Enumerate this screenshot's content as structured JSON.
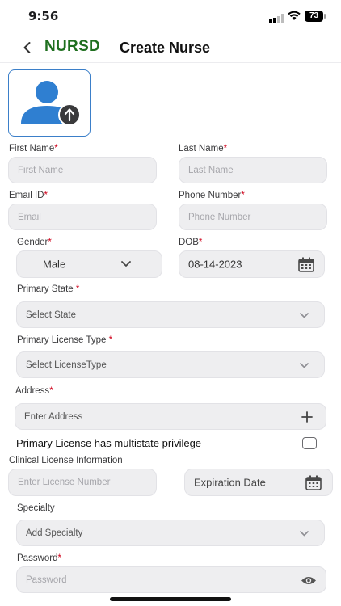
{
  "status_bar": {
    "time": "9:56",
    "battery": "73"
  },
  "header": {
    "brand": "NURSD",
    "title": "Create Nurse",
    "brand_color": "#1f6f1f"
  },
  "avatar": {
    "icon": "user-upload-icon",
    "accent": "#2f7fd1"
  },
  "form": {
    "first_name": {
      "label": "First Name",
      "placeholder": "First Name"
    },
    "last_name": {
      "label": "Last Name",
      "placeholder": "Last Name"
    },
    "email": {
      "label": "Email ID",
      "placeholder": "Email"
    },
    "phone": {
      "label": "Phone Number",
      "placeholder": "Phone Number"
    },
    "gender": {
      "label": "Gender",
      "value": "Male"
    },
    "dob": {
      "label": "DOB",
      "value": "08-14-2023"
    },
    "primary_state": {
      "label": "Primary State ",
      "placeholder": "Select State"
    },
    "license_type": {
      "label": "Primary License Type ",
      "placeholder": "Select LicenseType"
    },
    "address": {
      "label": "Address",
      "placeholder": "Enter Address"
    },
    "multistate": {
      "label": "Primary License has multistate privilege",
      "checked": false
    },
    "clinical": {
      "label": "Clinical License Information",
      "placeholder": "Enter License Number",
      "expiration_placeholder": "Expiration Date"
    },
    "specialty": {
      "label": "Specialty",
      "placeholder": "Add Specialty"
    },
    "password": {
      "label": "Password",
      "placeholder": "Password"
    },
    "required_marker": "*"
  }
}
